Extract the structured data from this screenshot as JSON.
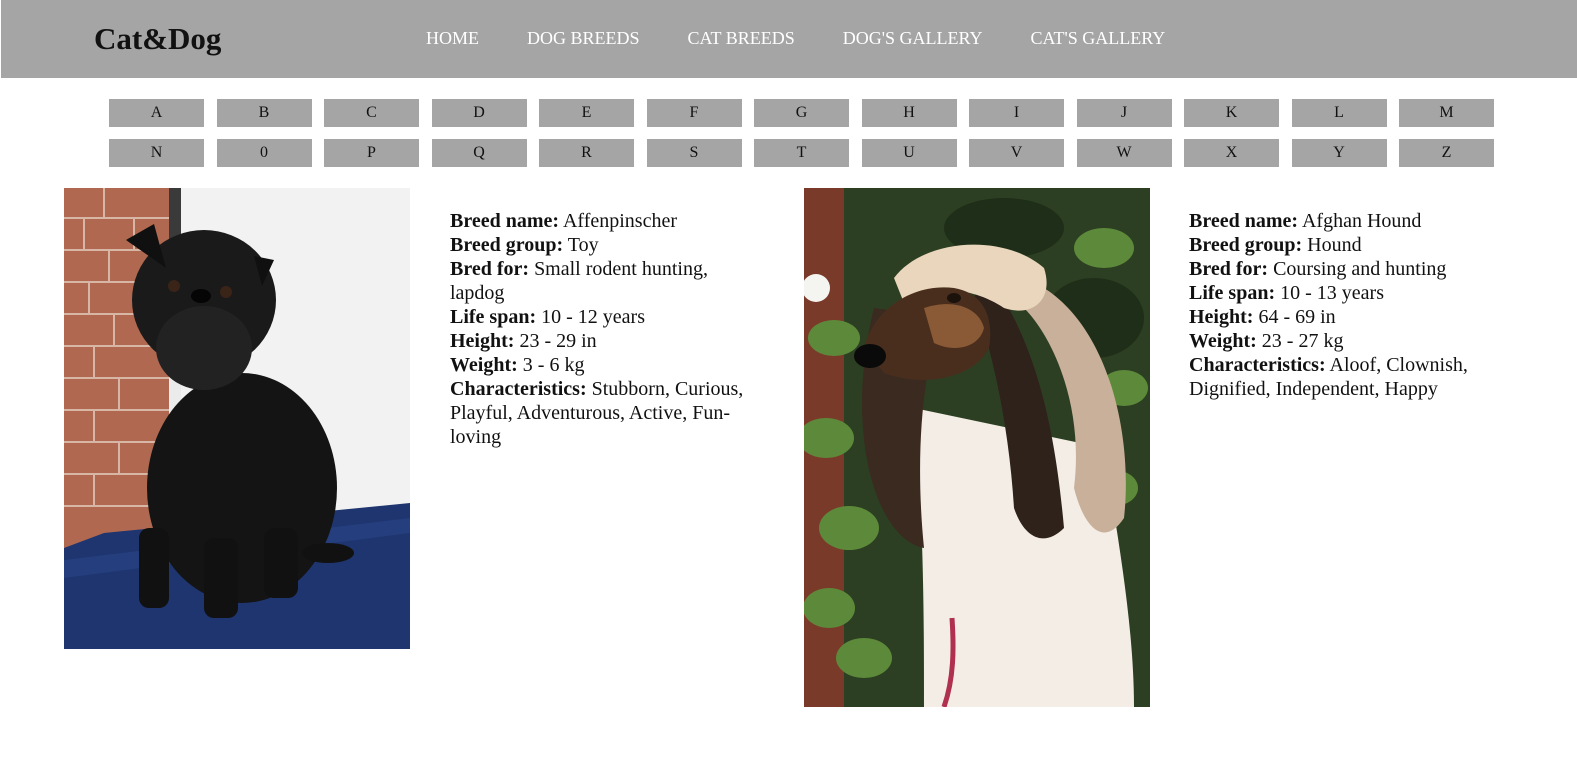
{
  "header": {
    "logo": "Cat&Dog",
    "nav": [
      "HOME",
      "DOG BREEDS",
      "CAT BREEDS",
      "DOG'S GALLERY",
      "CAT'S GALLERY"
    ]
  },
  "alphabet": {
    "row1": [
      "A",
      "B",
      "C",
      "D",
      "E",
      "F",
      "G",
      "H",
      "I",
      "J",
      "K",
      "L",
      "M"
    ],
    "row2": [
      "N",
      "0",
      "P",
      "Q",
      "R",
      "S",
      "T",
      "U",
      "V",
      "W",
      "X",
      "Y",
      "Z"
    ]
  },
  "labels": {
    "breed_name": "Breed name:",
    "breed_group": "Breed group:",
    "bred_for": "Bred for:",
    "life_span": "Life span:",
    "height": "Height:",
    "weight": "Weight:",
    "characteristics": "Characteristics:"
  },
  "breeds": [
    {
      "name": "Affenpinscher",
      "group": "Toy",
      "bred_for": "Small rodent hunting, lapdog",
      "life_span": "10 - 12 years",
      "height": "23 - 29 in",
      "weight": "3 - 6 kg",
      "characteristics": "Stubborn, Curious, Playful, Adventurous, Active, Fun-loving"
    },
    {
      "name": "Afghan Hound",
      "group": "Hound",
      "bred_for": "Coursing and hunting",
      "life_span": "10 - 13 years",
      "height": "64 - 69 in",
      "weight": "23 - 27 kg",
      "characteristics": "Aloof, Clownish, Dignified, Independent, Happy"
    }
  ]
}
